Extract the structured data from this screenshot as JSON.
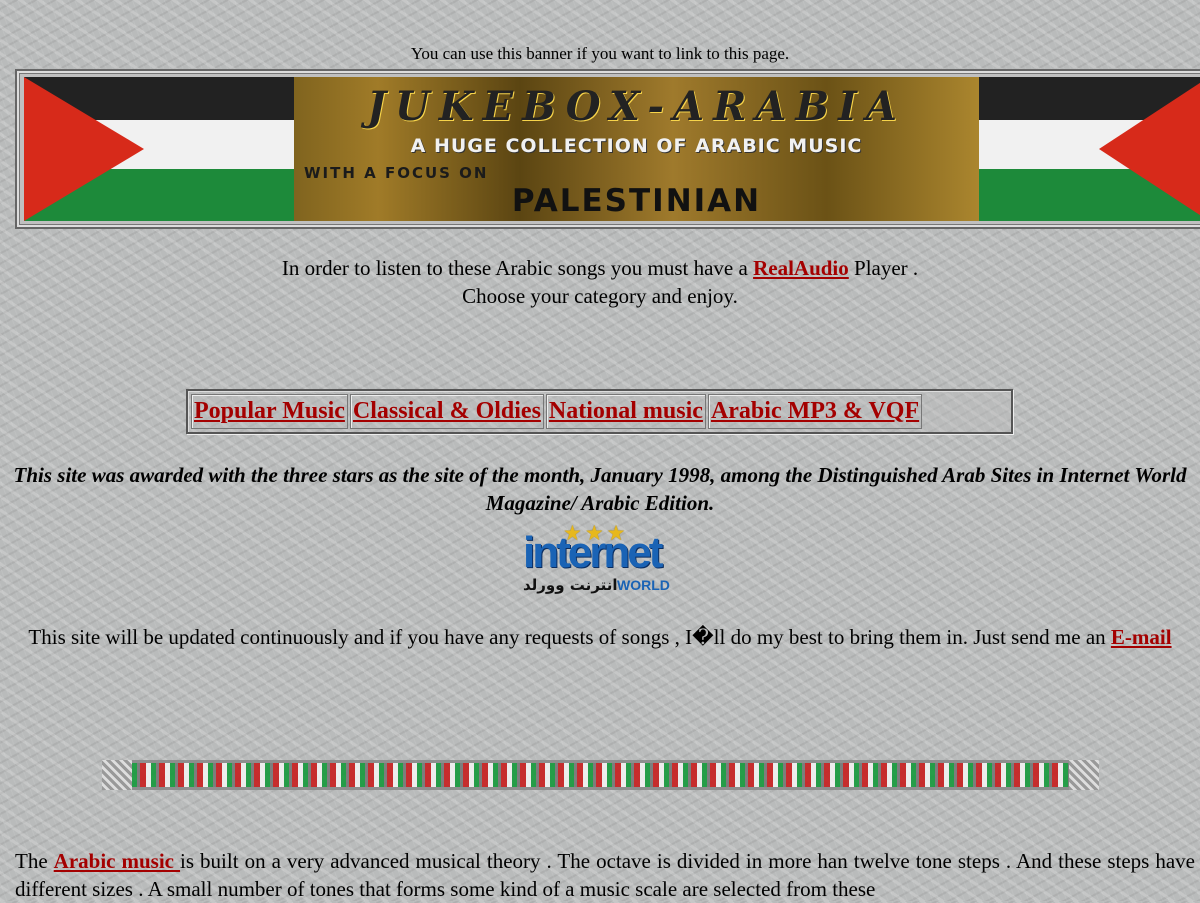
{
  "banner": {
    "caption": "You can use this banner if you want to link to this page.",
    "title": "JUKEBOX-ARABIA",
    "line1": "A HUGE COLLECTION OF ARABIC MUSIC",
    "line2": "WITH A FOCUS ON",
    "line3": "PALESTINIAN"
  },
  "intro": {
    "line1_before": "In order to listen to these Arabic songs you must have a ",
    "line1_link": "RealAudio",
    "line1_after": " Player .",
    "line2": "Choose your category and enjoy."
  },
  "categories": [
    "Popular Music",
    "Classical & Oldies",
    "National music",
    "Arabic MP3 & VQF"
  ],
  "award": {
    "text": "This site was awarded with the three stars as the site of the month, January 1998, among the Distinguished Arab Sites in Internet World Magazine/ Arabic Edition."
  },
  "logo": {
    "stars": "★★★",
    "word": "internet",
    "arabic": "انترنت وورلد",
    "world": "WORLD"
  },
  "update": {
    "text_before": "This site will be updated continuously and if you have any requests of songs , I�ll do my best to bring them in. Just send me an ",
    "link": "E-mail"
  },
  "bottom": {
    "text_before": "The ",
    "link": "Arabic music ",
    "text_after": "is built on a very advanced musical theory . The octave is divided in more han twelve tone steps . And these steps have different sizes . A small number of tones that forms some kind of a music scale are selected from these"
  }
}
